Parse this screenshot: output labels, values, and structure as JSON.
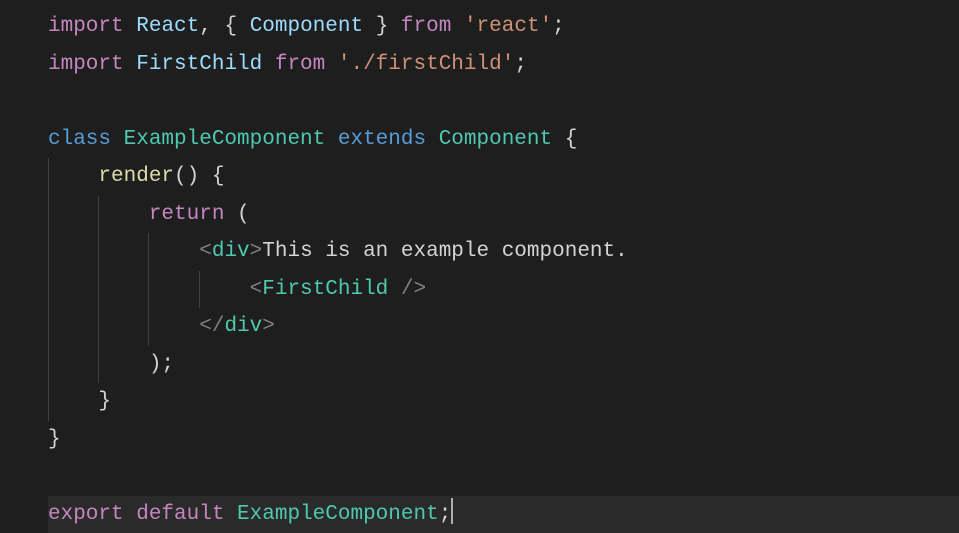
{
  "code": {
    "l1": {
      "import": "import",
      "react": "React",
      "comma": ", ",
      "lbrace": "{ ",
      "component": "Component",
      "rbrace": " }",
      "from": " from ",
      "path": "'react'",
      "semi": ";"
    },
    "l2": {
      "import": "import",
      "firstchild": " FirstChild",
      "from": " from ",
      "path": "'./firstChild'",
      "semi": ";"
    },
    "l4": {
      "class": "class",
      "name": " ExampleComponent",
      "extends": " extends",
      "base": " Component",
      "brace": " {"
    },
    "l5": {
      "indent": "    ",
      "render": "render",
      "parens": "()",
      "brace": " {"
    },
    "l6": {
      "indent": "        ",
      "return": "return",
      "paren": " ("
    },
    "l7": {
      "indent": "            ",
      "open": "<",
      "tag": "div",
      "close": ">",
      "text": "This is an example component."
    },
    "l8": {
      "indent": "                ",
      "open": "<",
      "tag": "FirstChild",
      "close": " />"
    },
    "l9": {
      "indent": "            ",
      "open": "</",
      "tag": "div",
      "close": ">"
    },
    "l10": {
      "indent": "        ",
      "paren": ");"
    },
    "l11": {
      "indent": "    ",
      "brace": "}"
    },
    "l12": {
      "brace": "}"
    },
    "l14": {
      "export": "export",
      "default": " default",
      "name": " ExampleComponent",
      "semi": ";"
    }
  }
}
